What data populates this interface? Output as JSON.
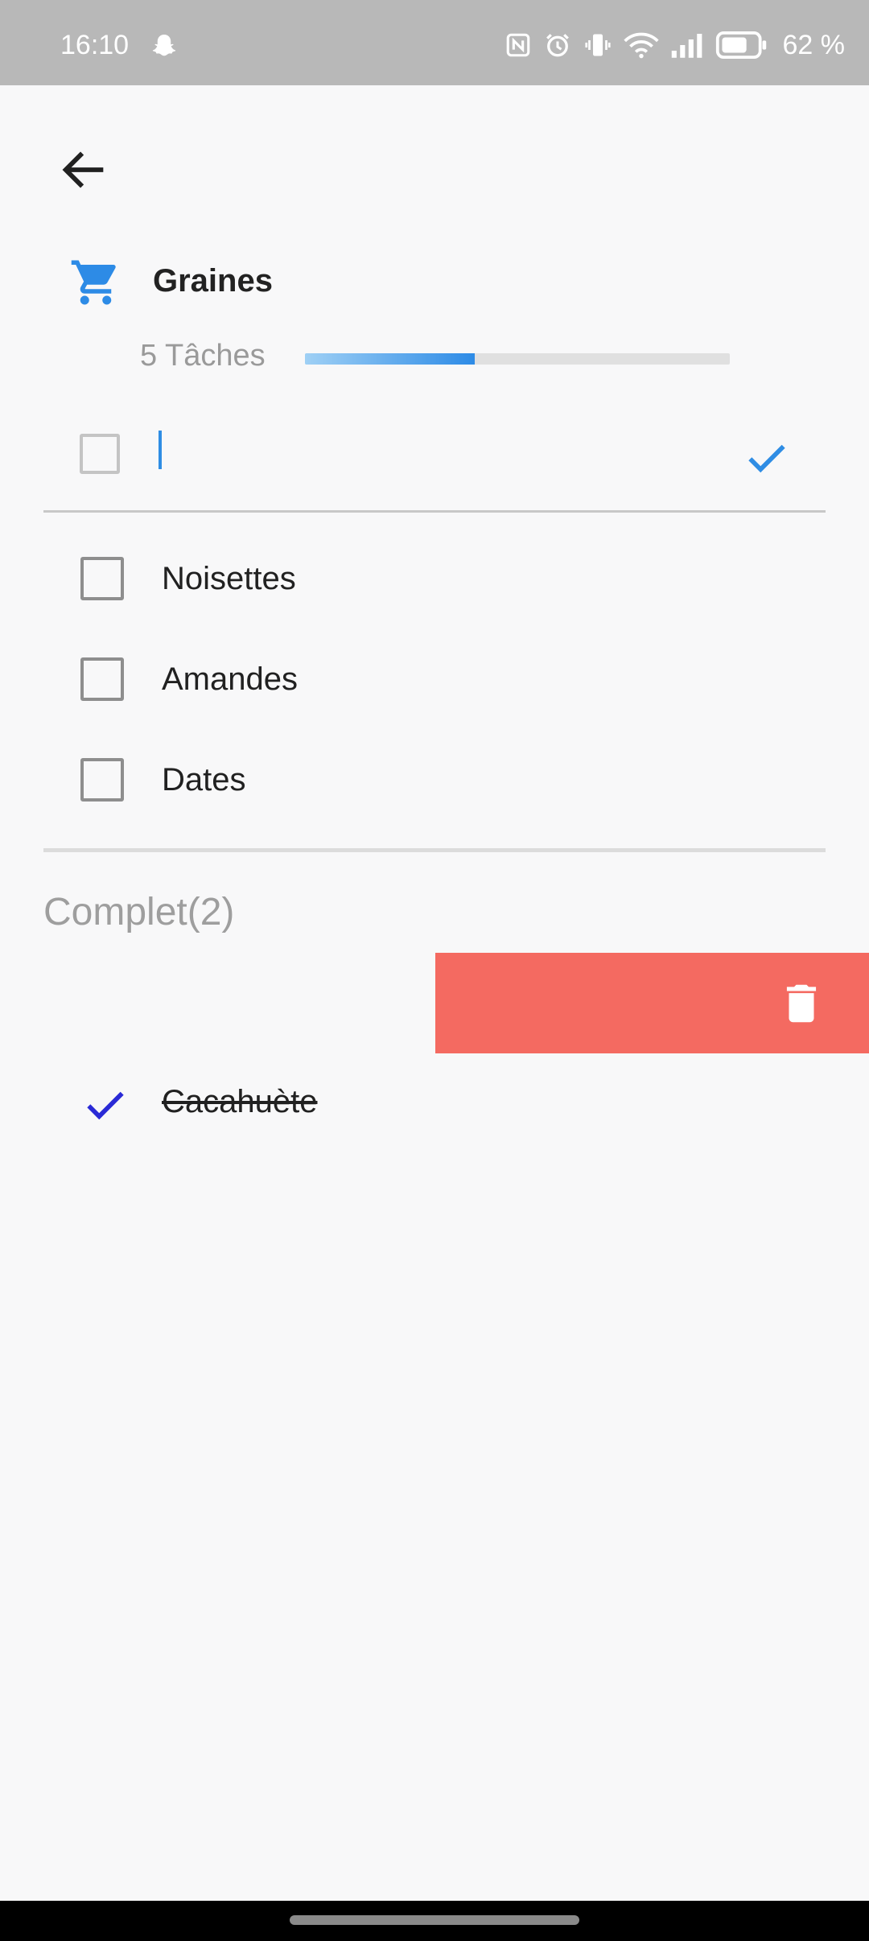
{
  "status_bar": {
    "time": "16:10",
    "battery_text": "62 %",
    "icons": [
      "snapchat-icon",
      "nfc-icon",
      "alarm-icon",
      "vibrate-icon",
      "wifi-icon",
      "signal-icon",
      "battery-icon"
    ]
  },
  "header": {
    "back_icon": "arrow-back-icon",
    "list_icon": "shopping-cart-icon",
    "list_title": "Graines",
    "task_count": "5 Tâches",
    "progress_fraction": 0.4,
    "accent_color": "#2d8be6"
  },
  "new_item": {
    "value": "",
    "placeholder": "",
    "confirm_icon": "check-icon"
  },
  "todos": [
    {
      "label": "Noisettes",
      "checked": false
    },
    {
      "label": "Amandes",
      "checked": false
    },
    {
      "label": "Dates",
      "checked": false
    }
  ],
  "completed_section": {
    "title": "Complet(2)",
    "delete_color": "#f46a61",
    "delete_icon": "trash-icon",
    "items": [
      {
        "label": "Cacahuète",
        "checked": true
      }
    ]
  }
}
